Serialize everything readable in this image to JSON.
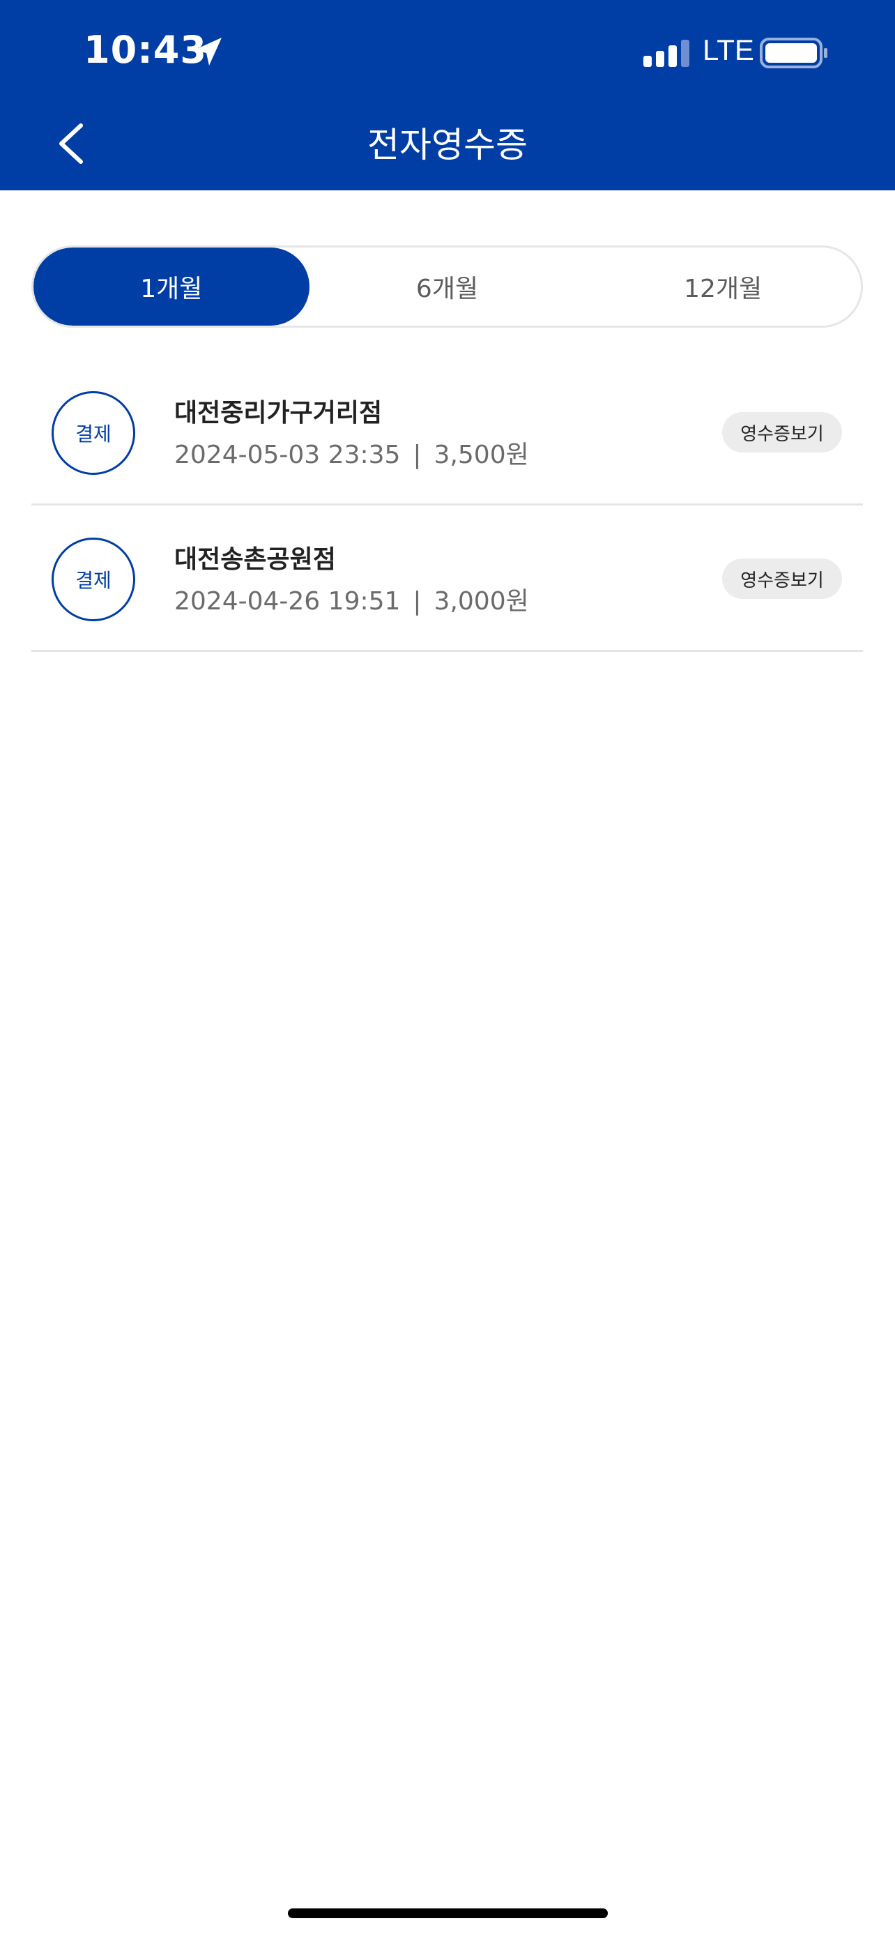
{
  "status_bar": {
    "time": "10:43",
    "network": "LTE",
    "location_icon": "location-arrow-icon",
    "signal_icon": "cellular-signal-icon",
    "battery_icon": "battery-icon"
  },
  "header": {
    "title": "전자영수증",
    "back_icon": "chevron-left-icon",
    "background": "#003DA5"
  },
  "period_tabs": [
    {
      "label": "1개월",
      "active": true
    },
    {
      "label": "6개월",
      "active": false
    },
    {
      "label": "12개월",
      "active": false
    }
  ],
  "receipts": [
    {
      "badge": "결제",
      "store": "대전중리가구거리점",
      "datetime": "2024-05-03 23:35",
      "separator": "|",
      "amount": "3,500원",
      "action": "영수증보기"
    },
    {
      "badge": "결제",
      "store": "대전송촌공원점",
      "datetime": "2024-04-26 19:51",
      "separator": "|",
      "amount": "3,000원",
      "action": "영수증보기"
    }
  ],
  "colors": {
    "accent": "#003DA5",
    "chip_background": "#ECECEC",
    "divider": "#E4E4E4"
  }
}
